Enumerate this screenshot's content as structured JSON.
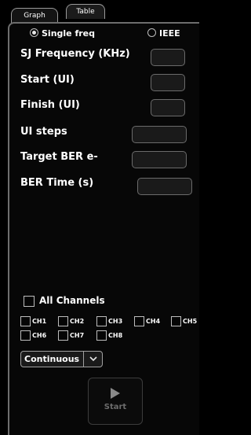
{
  "tabs": {
    "graph": "Graph",
    "table": "Table"
  },
  "mode": {
    "single_label": "Single freq",
    "ieee_label": "IEEE",
    "selected": "Single freq"
  },
  "fields": [
    {
      "label": "SJ Frequency (KHz)",
      "value": ""
    },
    {
      "label": "Start (UI)",
      "value": ""
    },
    {
      "label": "Finish (UI)",
      "value": ""
    },
    {
      "label": "UI steps",
      "value": ""
    },
    {
      "label": "Target BER e-",
      "value": ""
    },
    {
      "label": "BER Time (s)",
      "value": ""
    }
  ],
  "channels": {
    "all_label": "All Channels",
    "items": [
      "CH1",
      "CH2",
      "CH3",
      "CH4",
      "CH5",
      "CH6",
      "CH7",
      "CH8"
    ]
  },
  "run_mode": {
    "value": "Continuous"
  },
  "start_button": {
    "label": "Start"
  },
  "colors": {
    "background": "#000000",
    "panel_border": "#6d6d6d",
    "input_fill": "#1a1a1a",
    "disabled_text": "#6c6c6c"
  }
}
